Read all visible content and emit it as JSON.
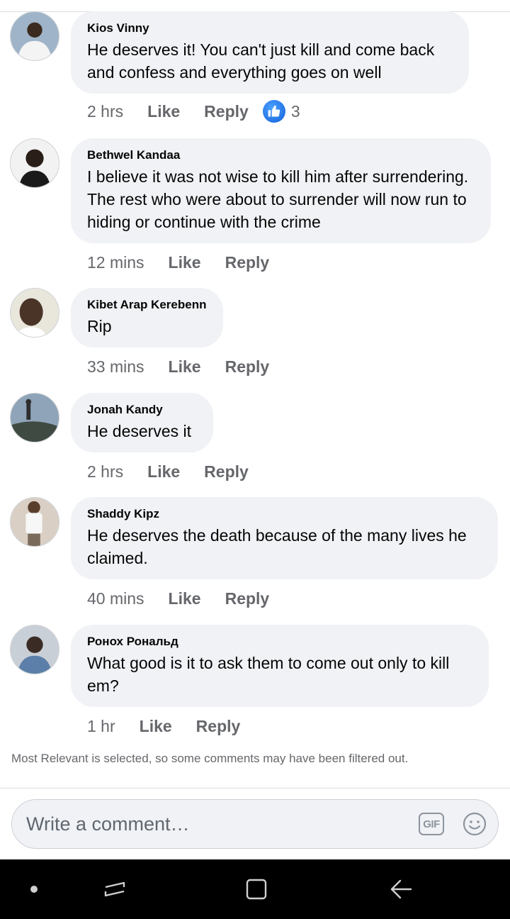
{
  "comments": [
    {
      "author": "Kios Vinny",
      "text": "He deserves it! You can't just kill and come back and confess and everything goes on well",
      "time": "2 hrs",
      "like_label": "Like",
      "reply_label": "Reply",
      "reaction_count": "3",
      "avatar_colors": {
        "bg": "#9fb4c8",
        "skin": "#3b2a20",
        "shirt": "#f4f4f4"
      }
    },
    {
      "author": "Bethwel Kandaa",
      "text": "I believe it was not wise to kill him after surrendering. The rest who were about to surrender will now run to hiding or continue with the crime",
      "time": "12 mins",
      "like_label": "Like",
      "reply_label": "Reply",
      "avatar_colors": {
        "bg": "#f2f2f2",
        "skin": "#2a1e18",
        "shirt": "#1a1a1a"
      }
    },
    {
      "author": "Kibet Arap Kerebenn",
      "text": "Rip",
      "time": "33 mins",
      "like_label": "Like",
      "reply_label": "Reply",
      "avatar_colors": {
        "bg": "#e9e6dc",
        "skin": "#4a3428",
        "shirt": "#ffffff"
      }
    },
    {
      "author": "Jonah Kandy",
      "text": "He deserves it",
      "time": "2 hrs",
      "like_label": "Like",
      "reply_label": "Reply",
      "avatar_colors": {
        "bg": "#8fa4b8",
        "skin": "#2d2d2d",
        "shirt": "#3f4a42"
      }
    },
    {
      "author": "Shaddy Kipz",
      "text": "He deserves the death because of the many lives he claimed.",
      "time": "40 mins",
      "like_label": "Like",
      "reply_label": "Reply",
      "avatar_colors": {
        "bg": "#d9cfc4",
        "skin": "#5a3e2c",
        "shirt": "#f7f7f7"
      }
    },
    {
      "author": "Ронох Рональд",
      "text": "What good is it to ask them to come out only to kill em?",
      "time": "1 hr",
      "like_label": "Like",
      "reply_label": "Reply",
      "avatar_colors": {
        "bg": "#c9cfd6",
        "skin": "#3a2c24",
        "shirt": "#5b7fa8"
      }
    }
  ],
  "filter_note": "Most Relevant is selected, so some comments may have been filtered out.",
  "composer": {
    "placeholder": "Write a comment…",
    "gif_label": "GIF"
  },
  "icons": {
    "reaction": "like-thumb-icon",
    "emoji": "smiley-icon",
    "nav": [
      "dot-icon",
      "recent-apps-icon",
      "home-square-icon",
      "back-arrow-icon"
    ]
  },
  "colors": {
    "bubble": "#f0f2f5",
    "meta_text": "#65676b",
    "like_blue": "#1877f2",
    "navbar": "#000000"
  }
}
